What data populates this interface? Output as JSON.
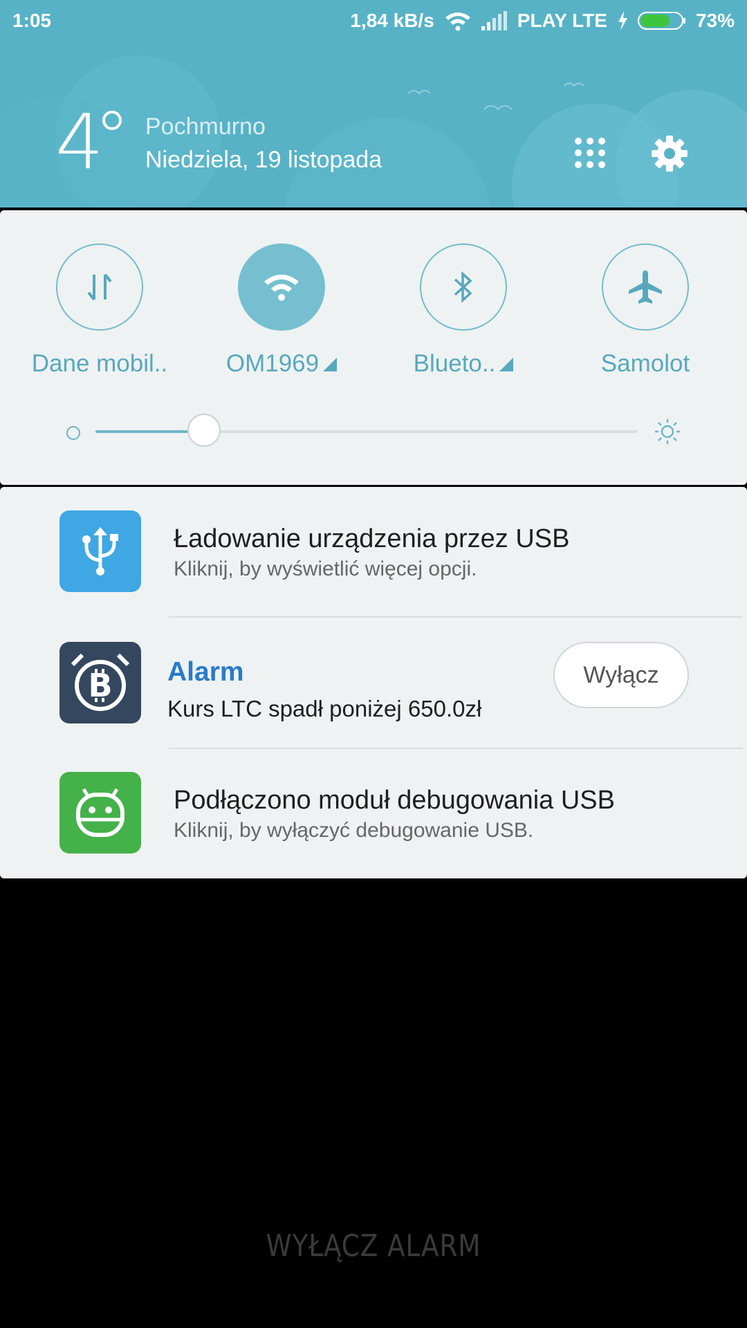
{
  "status_bar": {
    "time": "1:05",
    "speed": "1,84 kB/s",
    "carrier": "PLAY LTE",
    "battery": "73%",
    "battery_level": 0.73,
    "icons": [
      "wifi-icon",
      "signal-icon",
      "charging-icon",
      "battery-icon"
    ]
  },
  "weather": {
    "temperature": "4",
    "condition": "Pochmurno",
    "date": "Niedziela, 19 listopada"
  },
  "header_icons": [
    "apps-grid-icon",
    "gear-icon"
  ],
  "quick_settings": {
    "toggles": [
      {
        "label": "Dane mobil..",
        "icon": "mobile-data-icon",
        "active": false,
        "has_more": false
      },
      {
        "label": "OM1969",
        "icon": "wifi-icon",
        "active": true,
        "has_more": true
      },
      {
        "label": "Blueto..",
        "icon": "bluetooth-icon",
        "active": false,
        "has_more": true
      },
      {
        "label": "Samolot",
        "icon": "airplane-icon",
        "active": false,
        "has_more": false
      }
    ],
    "brightness": 0.2
  },
  "notifications": [
    {
      "title": "Ładowanie urządzenia przez USB",
      "text": "Kliknij, by wyświetlić więcej opcji.",
      "icon": "usb-icon",
      "color": "#3fa7e3"
    },
    {
      "title": "Alarm",
      "text": "Kurs LTC spadł poniżej 650.0zł",
      "icon": "bitcoin-alarm-icon",
      "color": "#34475e",
      "action": "Wyłącz",
      "title_color": "#2a7bc9"
    },
    {
      "title": "Podłączono moduł debugowania USB",
      "text": "Kliknij, by wyłączyć debugowanie USB.",
      "icon": "android-icon",
      "color": "#44b149"
    }
  ],
  "dismiss_label": "WYŁĄCZ ALARM"
}
